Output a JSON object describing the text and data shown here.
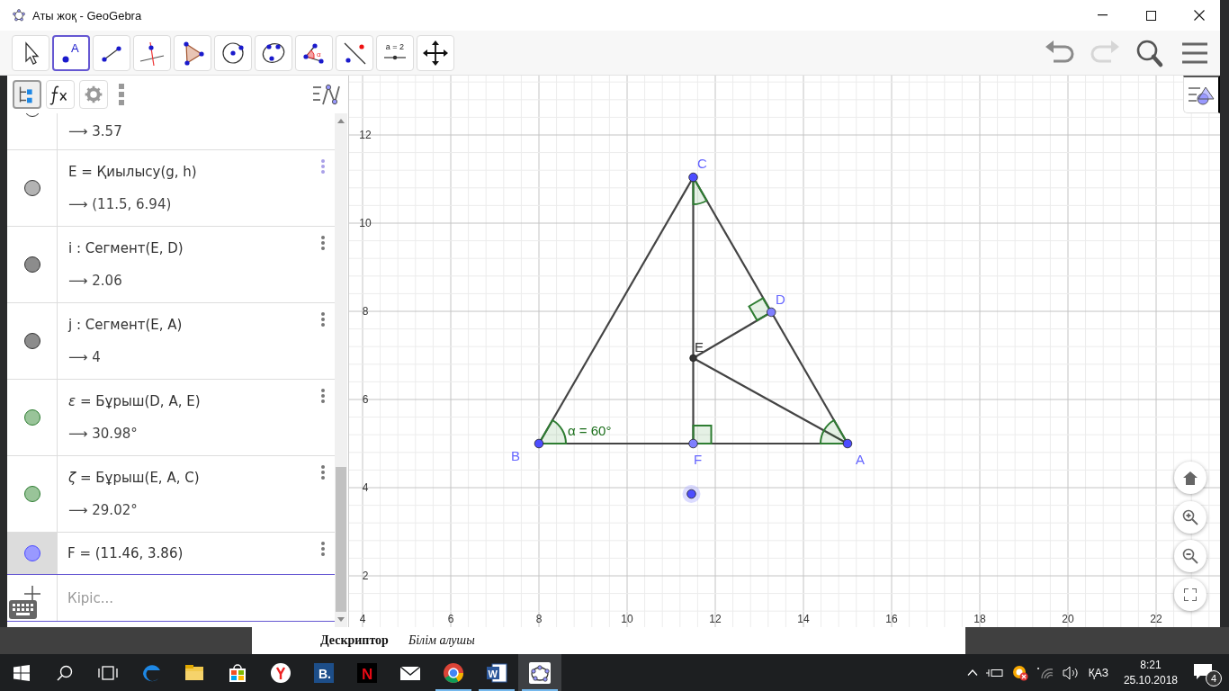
{
  "window": {
    "title": "Аты жоқ - GeoGebra"
  },
  "toolbar": {
    "tools": [
      {
        "kind": "move",
        "selected": false
      },
      {
        "kind": "point",
        "label": "A",
        "selected": true
      },
      {
        "kind": "segment",
        "selected": false
      },
      {
        "kind": "perpendicular",
        "selected": false
      },
      {
        "kind": "polygon",
        "selected": false
      },
      {
        "kind": "circle",
        "selected": false
      },
      {
        "kind": "conic",
        "selected": false
      },
      {
        "kind": "angle",
        "label": "α",
        "selected": false
      },
      {
        "kind": "reflect",
        "selected": false
      },
      {
        "kind": "slider",
        "label": "a = 2",
        "selected": false
      },
      {
        "kind": "pan",
        "selected": false
      }
    ],
    "actions": [
      {
        "kind": "undo",
        "disabled": false
      },
      {
        "kind": "redo",
        "disabled": true
      },
      {
        "kind": "search"
      },
      {
        "kind": "menu"
      }
    ]
  },
  "algebra": {
    "tabs": [
      {
        "kind": "algebra",
        "selected": true
      },
      {
        "kind": "tools",
        "selected": false
      },
      {
        "kind": "settings",
        "selected": false
      }
    ],
    "rows": [
      {
        "kind": "output_only",
        "color": "#ffffff",
        "output": "⟶  3.57",
        "selected": false
      },
      {
        "kind": "full",
        "color": "#b3b3b3",
        "definition": "E = Қиылысу(g, h)",
        "output": "⟶  (11.5, 6.94)",
        "selected": false
      },
      {
        "kind": "full",
        "color": "#8c8c8c",
        "definition": "i : Сегмент(E, D)",
        "output": "⟶  2.06",
        "selected": false
      },
      {
        "kind": "full",
        "color": "#8c8c8c",
        "definition": "j : Сегмент(E, A)",
        "output": "⟶  4",
        "selected": false
      },
      {
        "kind": "full",
        "color": "#99c499",
        "definition": "*ε* = Бұрыш(D, A, E)",
        "output": "⟶  30.98°",
        "selected": false
      },
      {
        "kind": "full",
        "color": "#99c499",
        "definition": "*ζ* = Бұрыш(E, A, C)",
        "output": "⟶  29.02°",
        "selected": false
      },
      {
        "kind": "value_only",
        "color": "#9999ff",
        "definition": "F = (11.46, 3.86)",
        "selected": true
      }
    ],
    "input": {
      "placeholder": "Кіріс..."
    }
  },
  "graphics": {
    "x_ticks": [
      "4",
      "6",
      "8",
      "10",
      "12",
      "14",
      "16",
      "18",
      "20",
      "22"
    ],
    "y_ticks": [
      "12",
      "10",
      "8",
      "6",
      "4",
      "2"
    ],
    "points": [
      {
        "label": "A",
        "color": "#4d4dff"
      },
      {
        "label": "B",
        "color": "#4d4dff"
      },
      {
        "label": "C",
        "color": "#4d4dff"
      },
      {
        "label": "D",
        "color": "#7f7fff"
      },
      {
        "label": "E",
        "color": "#333333"
      },
      {
        "label": "F",
        "color": "#7f7fff"
      }
    ],
    "angle_label": "α = 60°"
  },
  "document": {
    "texts": [
      "Дескриптор",
      "Білім алушы"
    ]
  },
  "taskbar": {
    "buttons": [
      {
        "kind": "start"
      },
      {
        "kind": "search"
      },
      {
        "kind": "task_view"
      }
    ],
    "apps": [
      {
        "kind": "edge",
        "running": false,
        "active": false
      },
      {
        "kind": "explorer",
        "running": false,
        "active": false
      },
      {
        "kind": "store",
        "running": false,
        "active": false
      },
      {
        "kind": "yandex",
        "running": false,
        "active": false
      },
      {
        "kind": "booking",
        "glyph": "B.",
        "running": false,
        "active": false
      },
      {
        "kind": "netflix",
        "glyph": "N",
        "running": false,
        "active": false
      },
      {
        "kind": "mail",
        "running": false,
        "active": false
      },
      {
        "kind": "chrome",
        "running": true,
        "active": false
      },
      {
        "kind": "word",
        "glyph": "W",
        "running": true,
        "active": false
      },
      {
        "kind": "geogebra",
        "running": true,
        "active": true
      }
    ],
    "tray": {
      "language": "ҚАЗ",
      "time": "8:21",
      "date": "25.10.2018",
      "notifications": "4"
    }
  }
}
